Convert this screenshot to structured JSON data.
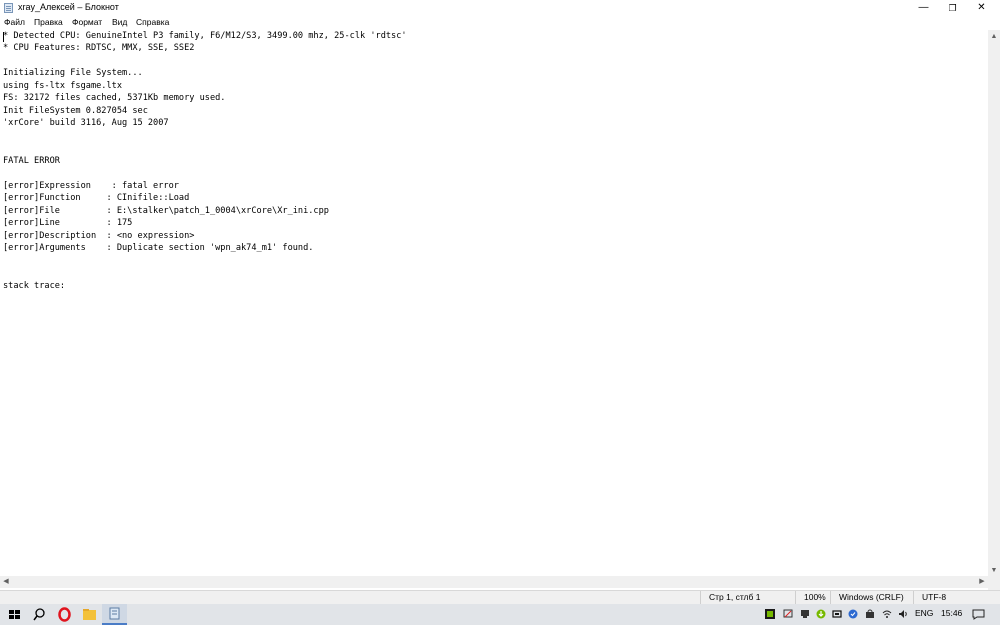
{
  "window": {
    "title": "xray_Алексей – Блокнот",
    "controls": {
      "minimize": "—",
      "maximize": "❐",
      "close": "✕"
    }
  },
  "menu": [
    "Файл",
    "Правка",
    "Формат",
    "Вид",
    "Справка"
  ],
  "document": {
    "lines": [
      "* Detected CPU: GenuineIntel P3 family, F6/M12/S3, 3499.00 mhz, 25-clk 'rdtsc'",
      "* CPU Features: RDTSC, MMX, SSE, SSE2",
      "",
      "Initializing File System...",
      "using fs-ltx fsgame.ltx",
      "FS: 32172 files cached, 5371Kb memory used.",
      "Init FileSystem 0.827054 sec",
      "'xrCore' build 3116, Aug 15 2007",
      "",
      "",
      "FATAL ERROR",
      "",
      "[error]Expression    : fatal error",
      "[error]Function     : CInifile::Load",
      "[error]File         : E:\\stalker\\patch_1_0004\\xrCore\\Xr_ini.cpp",
      "[error]Line         : 175",
      "[error]Description  : <no expression>",
      "[error]Arguments    : Duplicate section 'wpn_ak74_m1' found.",
      "",
      "",
      "stack trace:"
    ]
  },
  "status": {
    "position": "Стр 1, стлб 1",
    "zoom": "100%",
    "line_endings": "Windows (CRLF)",
    "encoding": "UTF-8"
  },
  "taskbar": {
    "language": "ENG",
    "time": "15:46"
  },
  "colors": {
    "taskbar_bg": "#e1e4e8",
    "opera_red": "#e0141e",
    "nvidia_green": "#76b900"
  }
}
